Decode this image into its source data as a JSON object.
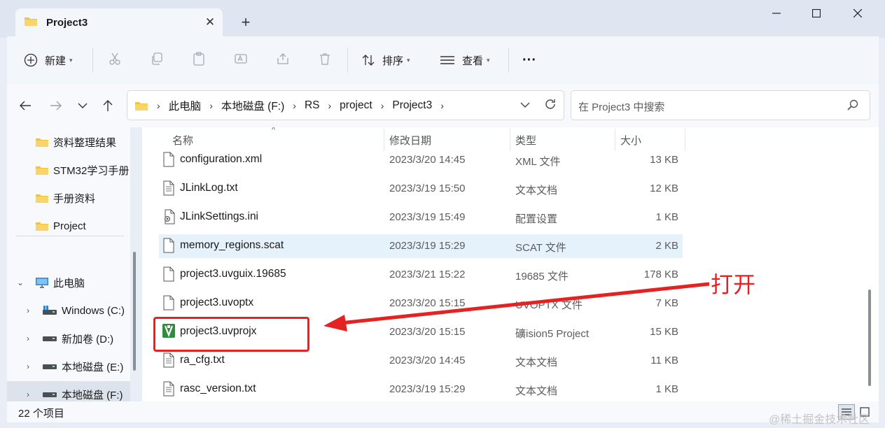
{
  "window": {
    "tab_title": "Project3",
    "new_tab": "+"
  },
  "commandbar": {
    "new_label": "新建",
    "sort_label": "排序",
    "view_label": "查看",
    "more_label": "···"
  },
  "address": {
    "crumbs": [
      "此电脑",
      "本地磁盘 (F:)",
      "RS",
      "project",
      "Project3"
    ],
    "search_placeholder": "在 Project3 中搜索"
  },
  "nav": {
    "quick_access": [
      {
        "label": "资料整理结果"
      },
      {
        "label": "STM32学习手册"
      },
      {
        "label": "手册资料"
      },
      {
        "label": "Project"
      }
    ],
    "this_pc": "此电脑",
    "drives": [
      {
        "label": "Windows (C:)"
      },
      {
        "label": "新加卷 (D:)"
      },
      {
        "label": "本地磁盘 (E:)"
      },
      {
        "label": "本地磁盘 (F:)"
      }
    ]
  },
  "columns": {
    "name": "名称",
    "date": "修改日期",
    "type": "类型",
    "size": "大小"
  },
  "files": [
    {
      "name": "configuration.xml",
      "date": "2023/3/20 14:45",
      "type": "XML 文件",
      "size": "13 KB"
    },
    {
      "name": "JLinkLog.txt",
      "date": "2023/3/19 15:50",
      "type": "文本文档",
      "size": "12 KB"
    },
    {
      "name": "JLinkSettings.ini",
      "date": "2023/3/19 15:49",
      "type": "配置设置",
      "size": "1 KB"
    },
    {
      "name": "memory_regions.scat",
      "date": "2023/3/19 15:29",
      "type": "SCAT 文件",
      "size": "2 KB"
    },
    {
      "name": "project3.uvguix.19685",
      "date": "2023/3/21 15:22",
      "type": "19685 文件",
      "size": "178 KB"
    },
    {
      "name": "project3.uvoptx",
      "date": "2023/3/20 15:15",
      "type": "UVOPTX 文件",
      "size": "7 KB"
    },
    {
      "name": "project3.uvprojx",
      "date": "2023/3/20 15:15",
      "type": "礦ision5 Project",
      "size": "15 KB"
    },
    {
      "name": "ra_cfg.txt",
      "date": "2023/3/20 14:45",
      "type": "文本文档",
      "size": "11 KB"
    },
    {
      "name": "rasc_version.txt",
      "date": "2023/3/19 15:29",
      "type": "文本文档",
      "size": "1 KB"
    }
  ],
  "status": {
    "item_count": "22 个项目"
  },
  "annotation": {
    "label": "打开",
    "color": "#e52222"
  },
  "watermark": "@稀土掘金技术社区"
}
